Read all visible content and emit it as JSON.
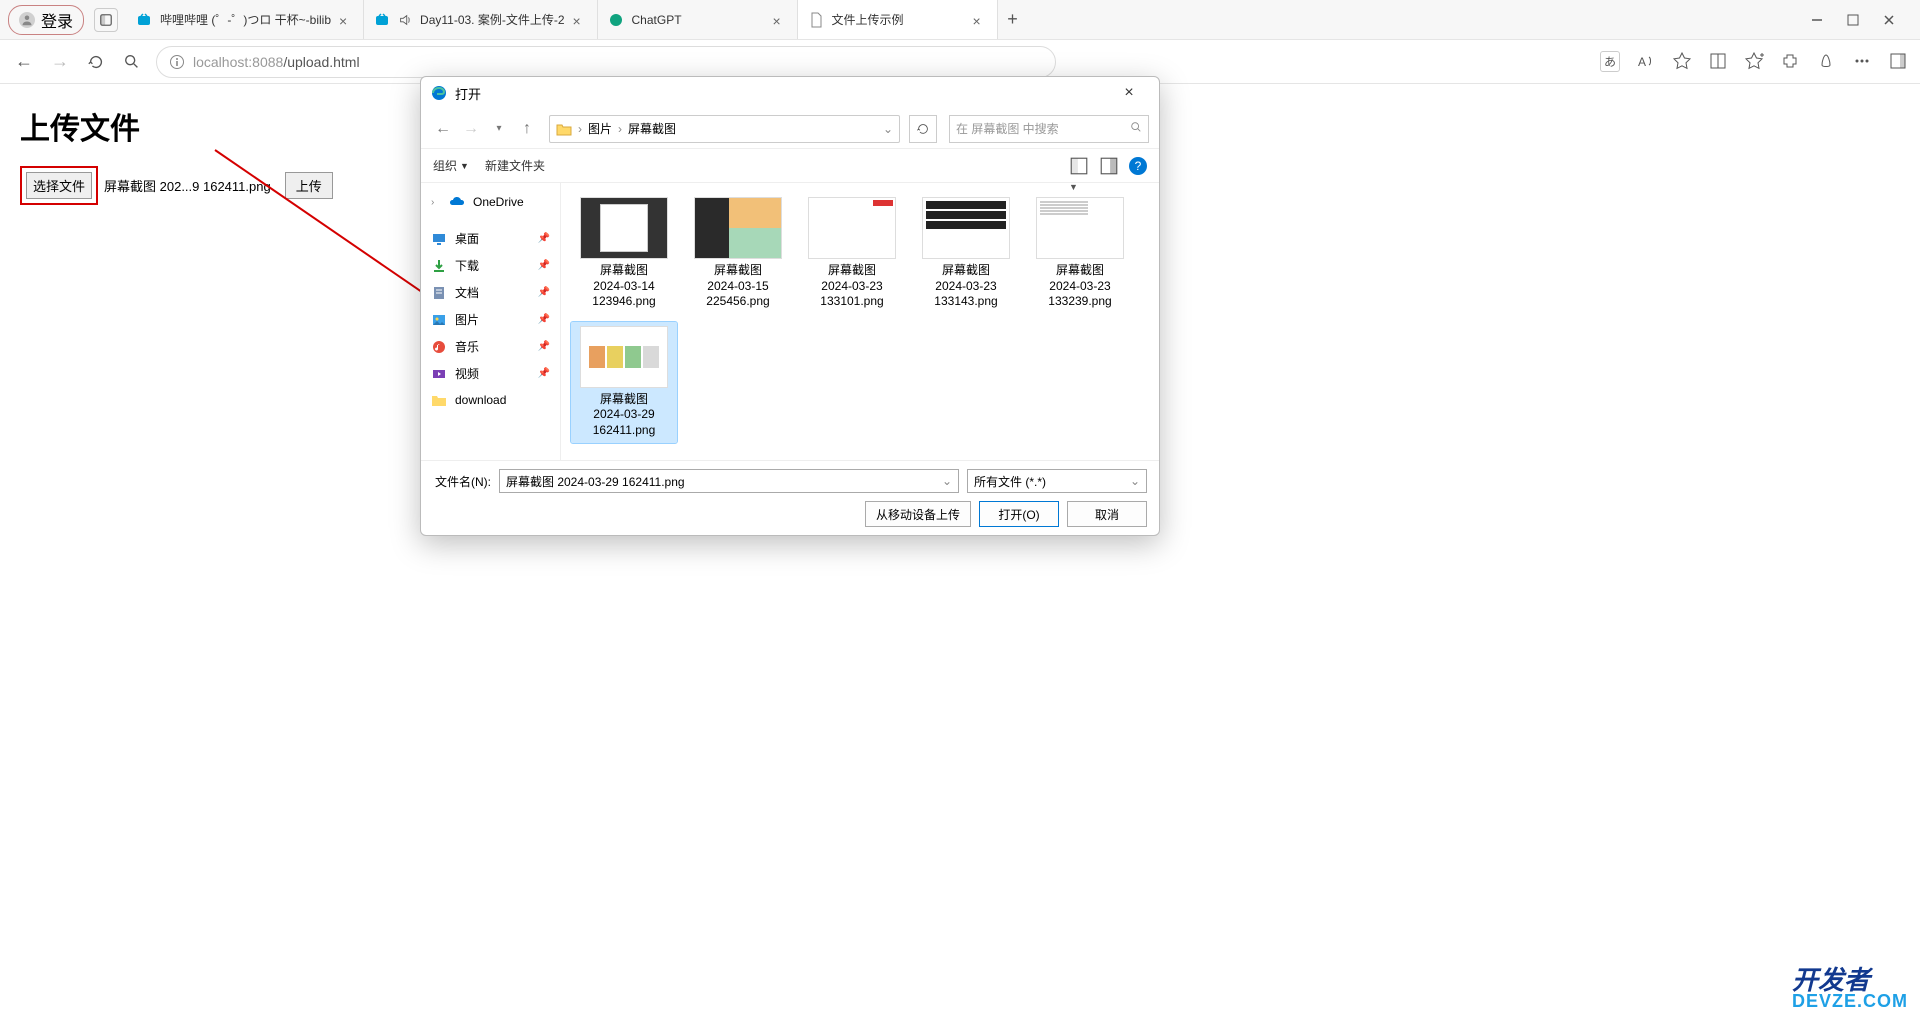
{
  "browser": {
    "profile_label": "登录",
    "tabs": [
      {
        "title": "哔哩哔哩 (゜-゜)つロ 干杯~-bilib",
        "icon": "bilibili"
      },
      {
        "title": "Day11-03. 案例-文件上传-2",
        "icon": "bilibili",
        "audio": true
      },
      {
        "title": "ChatGPT",
        "icon": "chatgpt"
      },
      {
        "title": "文件上传示例",
        "icon": "doc",
        "active": true
      }
    ],
    "url_host": "localhost",
    "url_port": ":8088",
    "url_path": "/upload.html",
    "lang_indicator": "あ"
  },
  "page": {
    "heading": "上传文件",
    "choose_btn": "选择文件",
    "chosen_filename": "屏幕截图 202...9 162411.png",
    "upload_btn": "上传"
  },
  "dialog": {
    "title": "打开",
    "breadcrumb": {
      "parts": [
        "图片",
        "屏幕截图"
      ]
    },
    "search_placeholder": "在 屏幕截图 中搜索",
    "toolbar": {
      "organize": "组织",
      "new_folder": "新建文件夹"
    },
    "sidebar": [
      {
        "label": "OneDrive",
        "icon": "onedrive",
        "chev": true
      },
      {
        "label": "桌面",
        "icon": "desktop",
        "pin": true
      },
      {
        "label": "下载",
        "icon": "download",
        "pin": true
      },
      {
        "label": "文档",
        "icon": "docs",
        "pin": true
      },
      {
        "label": "图片",
        "icon": "pictures",
        "pin": true
      },
      {
        "label": "音乐",
        "icon": "music",
        "pin": true
      },
      {
        "label": "视频",
        "icon": "video",
        "pin": true
      },
      {
        "label": "download",
        "icon": "folder"
      }
    ],
    "files": [
      {
        "lines": [
          "屏幕截图",
          "2024-03-14",
          "123946.png"
        ],
        "thumb": "tn1"
      },
      {
        "lines": [
          "屏幕截图",
          "2024-03-15",
          "225456.png"
        ],
        "thumb": "tn2"
      },
      {
        "lines": [
          "屏幕截图",
          "2024-03-23",
          "133101.png"
        ],
        "thumb": "tn3"
      },
      {
        "lines": [
          "屏幕截图",
          "2024-03-23",
          "133143.png"
        ],
        "thumb": "tn4"
      },
      {
        "lines": [
          "屏幕截图",
          "2024-03-23",
          "133239.png"
        ],
        "thumb": "tn5"
      },
      {
        "lines": [
          "屏幕截图",
          "2024-03-29",
          "162411.png"
        ],
        "thumb": "tn6",
        "selected": true
      }
    ],
    "filename_label": "文件名(N):",
    "filename_value": "屏幕截图 2024-03-29 162411.png",
    "filter_value": "所有文件 (*.*)",
    "buttons": {
      "mobile": "从移动设备上传",
      "open": "打开(O)",
      "cancel": "取消"
    }
  },
  "watermark": {
    "top": "开发者",
    "bottom": "DEVZE.COM"
  }
}
